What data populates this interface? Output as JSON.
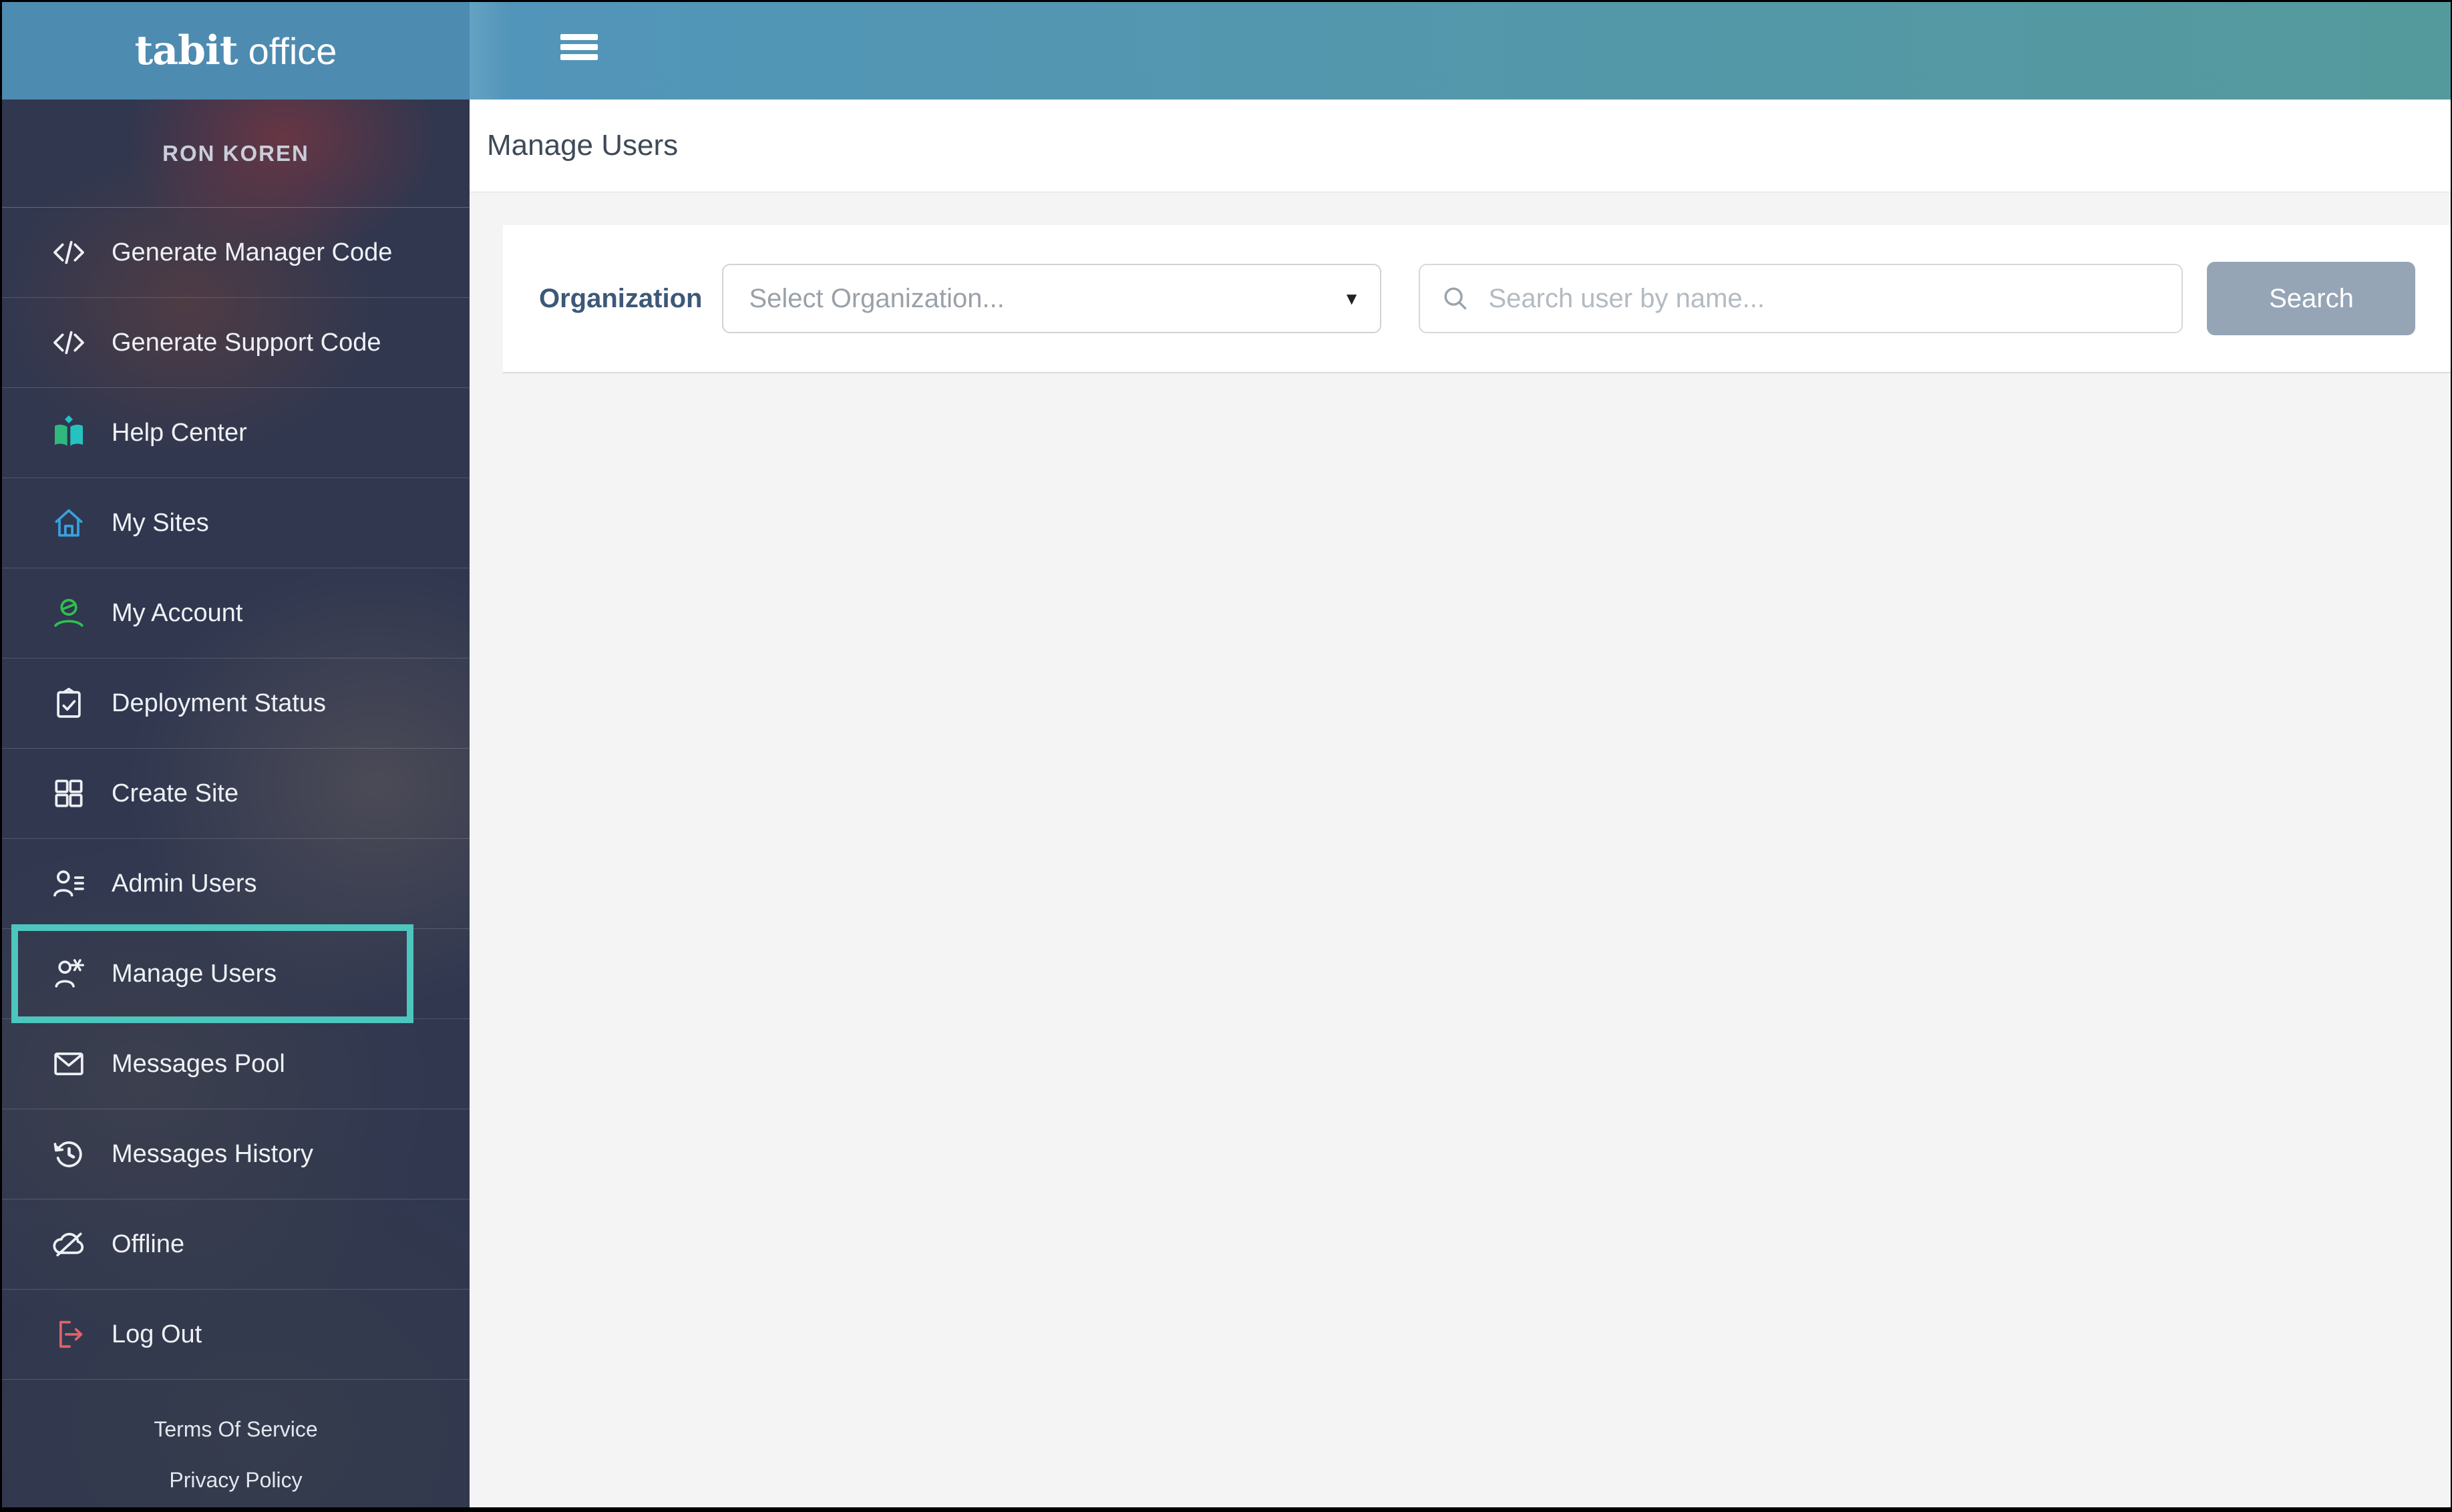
{
  "logo": {
    "brand_bold": "tabit",
    "brand_light": "office"
  },
  "topbar": {
    "menu_icon": "hamburger-icon"
  },
  "page": {
    "title": "Manage Users"
  },
  "sidebar": {
    "user_name": "RON KOREN",
    "items": [
      {
        "label": "Generate Manager Code",
        "icon": "code-icon",
        "selected": false
      },
      {
        "label": "Generate Support Code",
        "icon": "code-icon",
        "selected": false
      },
      {
        "label": "Help Center",
        "icon": "help-book-icon",
        "selected": false
      },
      {
        "label": "My Sites",
        "icon": "home-icon",
        "selected": false
      },
      {
        "label": "My Account",
        "icon": "account-icon",
        "selected": false
      },
      {
        "label": "Deployment Status",
        "icon": "clipboard-check-icon",
        "selected": false
      },
      {
        "label": "Create Site",
        "icon": "grid-icon",
        "selected": false
      },
      {
        "label": "Admin Users",
        "icon": "admin-users-icon",
        "selected": false
      },
      {
        "label": "Manage Users",
        "icon": "user-gear-icon",
        "selected": true
      },
      {
        "label": "Messages Pool",
        "icon": "envelope-icon",
        "selected": false
      },
      {
        "label": "Messages History",
        "icon": "history-icon",
        "selected": false
      },
      {
        "label": "Offline",
        "icon": "offline-cloud-icon",
        "selected": false
      },
      {
        "label": "Log Out",
        "icon": "logout-icon",
        "selected": false
      }
    ],
    "footer_links": [
      "Terms Of Service",
      "Privacy Policy"
    ]
  },
  "filters": {
    "organization_label": "Organization",
    "organization_placeholder": "Select Organization...",
    "search_placeholder": "Search user by name...",
    "search_button": "Search"
  },
  "colors": {
    "accent_teal": "#4DC6BE",
    "logo_bg": "#4E8BB1",
    "topbar_left": "#5295BA",
    "topbar_right": "#549A9C",
    "sidebar_bg": "#30374F",
    "logout_red": "#E2606B",
    "home_blue": "#38A1DD",
    "account_green": "#2EC14E",
    "book_green": "#2FB97D",
    "book_teal": "#25C3C0",
    "org_label_blue": "#3D5878",
    "search_button_bg": "#95A5B6"
  }
}
